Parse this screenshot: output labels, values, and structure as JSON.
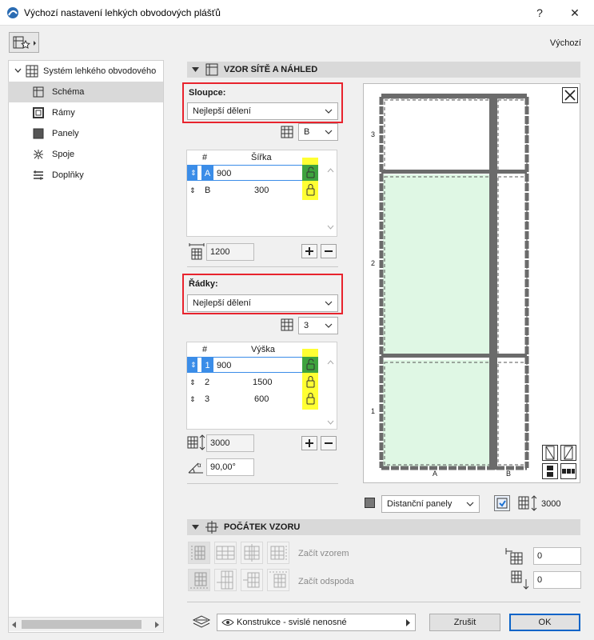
{
  "window": {
    "title": "Výchozí nastavení lehkých obvodových plášťů",
    "help": "?",
    "close": "✕"
  },
  "favorites_label": "Výchozí",
  "tree": {
    "root": "Systém lehkého obvodového",
    "items": [
      {
        "label": "Schéma",
        "icon": "schema-icon",
        "selected": true
      },
      {
        "label": "Rámy",
        "icon": "frames-icon",
        "selected": false
      },
      {
        "label": "Panely",
        "icon": "panels-icon",
        "selected": false
      },
      {
        "label": "Spoje",
        "icon": "joints-icon",
        "selected": false
      },
      {
        "label": "Doplňky",
        "icon": "accessories-icon",
        "selected": false
      }
    ]
  },
  "section_grid": {
    "title": "VZOR SÍTĚ A NÁHLED"
  },
  "columns": {
    "label": "Sloupce:",
    "mode": "Nejlepší dělení",
    "count": "B",
    "header_num": "#",
    "header_val": "Šířka",
    "rows": [
      {
        "id": "A",
        "value": "900",
        "locked": false,
        "selected": true
      },
      {
        "id": "B",
        "value": "300",
        "locked": true,
        "selected": false
      }
    ],
    "total": "1200"
  },
  "rows": {
    "label": "Řádky:",
    "mode": "Nejlepší dělení",
    "count": "3",
    "header_num": "#",
    "header_val": "Výška",
    "rows": [
      {
        "id": "1",
        "value": "900",
        "locked": false,
        "selected": true
      },
      {
        "id": "2",
        "value": "1500",
        "locked": true,
        "selected": false
      },
      {
        "id": "3",
        "value": "600",
        "locked": true,
        "selected": false
      }
    ],
    "total": "3000",
    "angle": "90,00°"
  },
  "preview": {
    "row_labels": [
      "3",
      "2",
      "1"
    ],
    "col_labels": [
      "A",
      "B"
    ],
    "panel_mode": "Distanční panely",
    "height_value": "3000"
  },
  "section_origin": {
    "title": "POČÁTEK VZORU",
    "start_pattern": "Začít vzorem",
    "start_bottom": "Začít odspoda",
    "x_value": "0",
    "y_value": "0"
  },
  "footer": {
    "layer": "Konstrukce - svislé nenosné",
    "cancel": "Zrušit",
    "ok": "OK"
  },
  "colors": {
    "highlight_red": "#e8232d",
    "lock_yellow": "#ffff33",
    "selected_blue": "#3b8de8",
    "panel_green": "#dff7e4",
    "mullion_gray": "#6b6b6b"
  }
}
